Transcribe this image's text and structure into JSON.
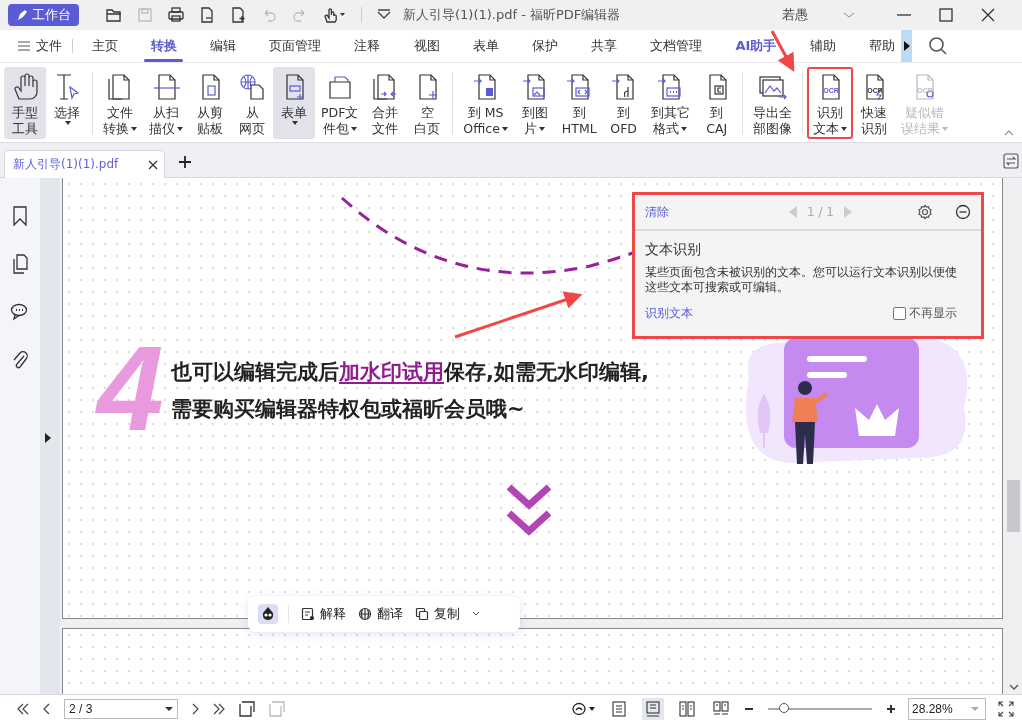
{
  "title_bar": {
    "workspace_button": "工作台",
    "document_title": "新人引导(1)(1).pdf - 福昕PDF编辑器",
    "user": "若愚"
  },
  "quick_toolbar": [
    {
      "disabled": false
    },
    {
      "disabled": true
    },
    {
      "disabled": false
    },
    {
      "disabled": false
    },
    {
      "disabled": false
    },
    {
      "disabled": true
    },
    {
      "disabled": true
    },
    {
      "disabled": false
    }
  ],
  "menu_tabs": [
    {
      "label": "文件",
      "kind": "file",
      "selected": false
    },
    {
      "label": "主页",
      "kind": "tab",
      "selected": false
    },
    {
      "label": "转换",
      "kind": "tab",
      "selected": true
    },
    {
      "label": "编辑",
      "kind": "tab",
      "selected": false
    },
    {
      "label": "页面管理",
      "kind": "tab",
      "selected": false
    },
    {
      "label": "注释",
      "kind": "tab",
      "selected": false
    },
    {
      "label": "视图",
      "kind": "tab",
      "selected": false
    },
    {
      "label": "表单",
      "kind": "tab",
      "selected": false
    },
    {
      "label": "保护",
      "kind": "tab",
      "selected": false
    },
    {
      "label": "共享",
      "kind": "tab",
      "selected": false
    },
    {
      "label": "文档管理",
      "kind": "tab",
      "selected": false
    },
    {
      "label": "AI助手",
      "kind": "ai",
      "selected": false
    },
    {
      "label": "辅助",
      "kind": "tab",
      "selected": false
    },
    {
      "label": "帮助",
      "kind": "tab",
      "selected": false
    }
  ],
  "ribbon_groups": [
    {
      "items": [
        {
          "lines": [
            "手型",
            "工具"
          ],
          "selected": true,
          "dropdown": false,
          "disabled": false,
          "annotated": false
        },
        {
          "lines": [
            "选择"
          ],
          "selected": false,
          "dropdown": true,
          "disabled": false,
          "annotated": false
        }
      ]
    },
    {
      "items": [
        {
          "lines": [
            "文件",
            "转换"
          ],
          "selected": false,
          "dropdown": true,
          "disabled": false,
          "annotated": false
        },
        {
          "lines": [
            "从扫",
            "描仪"
          ],
          "selected": false,
          "dropdown": true,
          "disabled": false,
          "annotated": false
        },
        {
          "lines": [
            "从剪",
            "贴板"
          ],
          "selected": false,
          "dropdown": false,
          "disabled": false,
          "annotated": false
        },
        {
          "lines": [
            "从",
            "网页"
          ],
          "selected": false,
          "dropdown": false,
          "disabled": false,
          "annotated": false
        },
        {
          "lines": [
            "表单"
          ],
          "selected": true,
          "dropdown": true,
          "disabled": false,
          "annotated": false
        },
        {
          "lines": [
            "PDF文",
            "件包"
          ],
          "selected": false,
          "dropdown": true,
          "disabled": false,
          "annotated": false
        },
        {
          "lines": [
            "合并",
            "文件"
          ],
          "selected": false,
          "dropdown": false,
          "disabled": false,
          "annotated": false
        },
        {
          "lines": [
            "空",
            "白页"
          ],
          "selected": false,
          "dropdown": false,
          "disabled": false,
          "annotated": false
        }
      ]
    },
    {
      "items": [
        {
          "lines": [
            "到 MS",
            "Office"
          ],
          "selected": false,
          "dropdown": true,
          "disabled": false,
          "annotated": false
        },
        {
          "lines": [
            "到图",
            "片"
          ],
          "selected": false,
          "dropdown": true,
          "disabled": false,
          "annotated": false
        },
        {
          "lines": [
            "到",
            "HTML"
          ],
          "selected": false,
          "dropdown": false,
          "disabled": false,
          "annotated": false
        },
        {
          "lines": [
            "到",
            "OFD"
          ],
          "selected": false,
          "dropdown": false,
          "disabled": false,
          "annotated": false
        },
        {
          "lines": [
            "到其它",
            "格式"
          ],
          "selected": false,
          "dropdown": true,
          "disabled": false,
          "annotated": false
        },
        {
          "lines": [
            "到",
            "CAJ"
          ],
          "selected": false,
          "dropdown": false,
          "disabled": false,
          "annotated": false
        }
      ]
    },
    {
      "items": [
        {
          "lines": [
            "导出全",
            "部图像"
          ],
          "selected": false,
          "dropdown": false,
          "disabled": false,
          "annotated": false
        }
      ]
    },
    {
      "items": [
        {
          "lines": [
            "识别",
            "文本"
          ],
          "badge": "OCR",
          "selected": false,
          "dropdown": true,
          "disabled": false,
          "annotated": true
        },
        {
          "lines": [
            "快速",
            "识别"
          ],
          "badge": "OCR",
          "selected": false,
          "dropdown": false,
          "disabled": false,
          "annotated": false
        },
        {
          "lines": [
            "疑似错",
            "误结果"
          ],
          "badge": "OCR",
          "selected": false,
          "dropdown": true,
          "disabled": true,
          "annotated": false
        }
      ]
    }
  ],
  "document_tabs": [
    {
      "label": "新人引导(1)(1).pdf",
      "selected": true
    }
  ],
  "page": {
    "step_number": "4",
    "message_lines": [
      [
        {
          "text": "也可以编辑完成后",
          "kind": "plain"
        },
        {
          "text": "加水印试用",
          "kind": "highlight"
        },
        {
          "text": "保存,如需无水印编辑,",
          "kind": "plain"
        }
      ],
      [
        {
          "text": "需要购买编辑器特权包或福昕会员哦~",
          "kind": "plain"
        }
      ]
    ]
  },
  "ocr_panel": {
    "clear": "清除",
    "pager": "1 / 1",
    "title": "文本识别",
    "description": "某些页面包含未被识别的文本。您可以运行文本识别以便使这些文本可搜索或可编辑。",
    "action": "识别文本",
    "dont_show": {
      "label": "不再显示",
      "checked": false
    },
    "annotated": true
  },
  "ai_toolbar": {
    "actions": [
      {
        "label": "解释"
      },
      {
        "label": "翻译"
      },
      {
        "label": "复制"
      }
    ]
  },
  "status_bar": {
    "page_field": "2 / 3",
    "view_modes": [
      {
        "selected": false
      },
      {
        "selected": true
      },
      {
        "selected": false
      },
      {
        "selected": false
      }
    ],
    "zoom": {
      "level": 0.12
    },
    "zoom_field": "28.28%"
  }
}
